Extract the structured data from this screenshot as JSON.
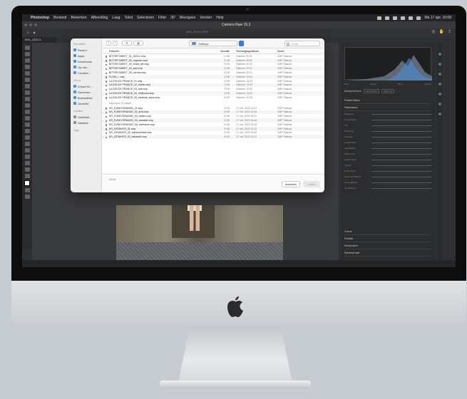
{
  "menubar": {
    "app_name": "Photoshop",
    "items": [
      "Bestand",
      "Bewerken",
      "Afbeelding",
      "Laag",
      "Tekst",
      "Selecteren",
      "Filter",
      "3D",
      "Weergave",
      "Venster",
      "Help"
    ],
    "datetime": "Ma 17 apr. 10:08"
  },
  "window": {
    "title": "Camera Raw 15.3",
    "document_tab": "IMG_2333.3...",
    "document_filename": "IMG_2333.3.JPG"
  },
  "camera_raw": {
    "histogram_meta": [
      "f/4.0",
      "1/4 sec",
      "ISO 4",
      "100mm"
    ],
    "profile_label": "Basisbewerken",
    "profile_buttons": [
      "Automatisch",
      "Zwart-wit"
    ],
    "profile_row": "Profiel  Kleur",
    "sections_open": "Standaard",
    "sliders": [
      "Witbalans",
      "Temperatuur",
      "Tint",
      "Belichting",
      "Contrast",
      "Hooglichten",
      "Schaduwen",
      "Witte tinten",
      "Zwarte tinten",
      "Textuur",
      "Helderheid",
      "Nevel verwijderen",
      "Levendigheid",
      "Verzadiging"
    ],
    "collapsed_sections": [
      "Curve",
      "Details",
      "Kleurmixer",
      "Kleurschaal"
    ]
  },
  "dialog": {
    "location": "Settings",
    "search_placeholder": "Zoek",
    "sidebar": {
      "favorites_title": "Favorieten",
      "favorites": [
        "Recent",
        "Apps",
        "Downloads",
        "Op min...",
        "Creative..."
      ],
      "icloud_title": "iCloud",
      "icloud": [
        "iCloud Dri...",
        "Documen...",
        "Bureaublad",
        "Gedeeld"
      ],
      "locations_title": "Locaties",
      "locations": [
        "DiskStati...",
        "Netwerk"
      ],
      "tags_title": "Tags"
    },
    "columns": {
      "name": "Gisteren",
      "size": "Grootte",
      "date": "Toevoegingsdatum",
      "kind": "Soort"
    },
    "files_yesterday": [
      {
        "name": "BITTER SWEET_01_IGOL2.xmp",
        "size": "5 KB",
        "date": "Gisteren 20:02",
        "kind": "XMP Sidecar"
      },
      {
        "name": "BITTER SWEET_02_nogreen.xmp",
        "size": "5 KB",
        "date": "Gisteren 20:02",
        "kind": "XMP Sidecar"
      },
      {
        "name": "BITTER SWEET_03_zwart_wit.xmp",
        "size": "5 KB",
        "date": "Gisteren 20:02",
        "kind": "XMP Sidecar"
      },
      {
        "name": "BITTER SWEET_04_soft.xmp",
        "size": "5 KB",
        "date": "Gisteren 20:01",
        "kind": "XMP Sidecar"
      },
      {
        "name": "BITTER SWEET_05_normal.xmp",
        "size": "5 KB",
        "date": "Gisteren 20:01",
        "kind": "XMP Sidecar"
      },
      {
        "name": "FLOW_I .xmp",
        "size": "4 KB",
        "date": "Gisteren 14:44",
        "kind": "XMP Sidecar"
      },
      {
        "name": "LA DOUCE FRANCE_01.xmp",
        "size": "4 KB",
        "date": "Gisteren 13:33",
        "kind": "XMP Sidecar"
      },
      {
        "name": "LA DOUCE FRANCE_02_helder.xmp",
        "size": "4 KB",
        "date": "Gisteren 13:33",
        "kind": "XMP Sidecar"
      },
      {
        "name": "LA DOUCE FRANCE_03_soft.xmp",
        "size": "4 KB",
        "date": "Gisteren 13:33",
        "kind": "XMP Sidecar"
      },
      {
        "name": "LA DOUCE FRANCE_04_mellownd.xmp",
        "size": "4 KB",
        "date": "Gisteren 13:33",
        "kind": "XMP Sidecar"
      },
      {
        "name": "LA DOUCE FRANCE_05_zwartwit_sepia.xmp",
        "size": "4 KB",
        "date": "Gisteren 13:35",
        "kind": "XMP Sidecar"
      }
    ],
    "subhead_30": "Afgelopen 30 dagen",
    "files_30days": [
      {
        "name": "KR_FUNKYORANGE_01.xmp",
        "size": "5 KB",
        "date": "17 mrt. 2023 15:17",
        "kind": "XMP Sidecar"
      },
      {
        "name": "KR_FUNKYORANGE_02_licht.xmp",
        "size": "5 KB",
        "date": "17 mrt. 2023 15:16",
        "kind": "XMP Sidecar"
      },
      {
        "name": "KR_FUNKYORANGE_03_helder.xmp",
        "size": "5 KB",
        "date": "17 mrt. 2023 15:17",
        "kind": "XMP Sidecar"
      },
      {
        "name": "KR_FUNKYORANGE_04_zwartwit.xmp",
        "size": "5 KB",
        "date": "17 mrt. 2023 15:18",
        "kind": "XMP Sidecar"
      },
      {
        "name": "KR_FUNKYORANGE_05_mellownd.xmp",
        "size": "5 KB",
        "date": "17 mrt. 2023 15:18",
        "kind": "XMP Sidecar"
      },
      {
        "name": "KR_ICEWHITE_01.xmp",
        "size": "5 KB",
        "date": "17 mrt. 2023 21:42",
        "kind": "XMP Sidecar"
      },
      {
        "name": "KR_ICEWHITE_02_extracontrast.xmp",
        "size": "5 KB",
        "date": "17 mrt. 2023 21:44",
        "kind": "XMP Sidecar"
      },
      {
        "name": "KR_ICEWHITE_03_extrasoft.xmp",
        "size": "5 KB",
        "date": "17 mrt. 2023 21:47",
        "kind": "XMP Sidecar"
      }
    ],
    "footer_label": "Media",
    "cancel_label": "Annuleer",
    "open_label": "Laden"
  },
  "colors": {
    "accent": "#2f7cf6",
    "photoshop_bg": "#2f3032",
    "dialog_bg": "#ffffff"
  }
}
